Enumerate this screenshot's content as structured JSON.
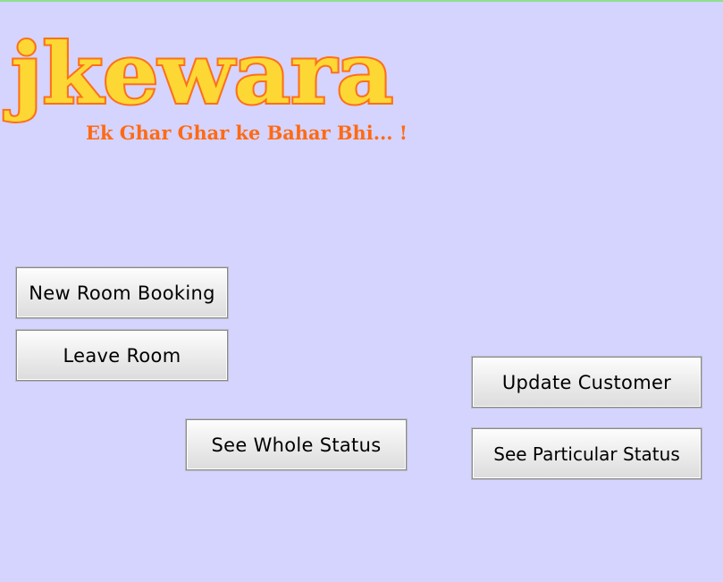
{
  "brand": {
    "name": "jkewara",
    "tagline": "Ek Ghar Ghar ke Bahar Bhi... !",
    "fill_color": "#fdd835",
    "outline_color": "#ff6f1a",
    "tagline_color": "#ff6a13"
  },
  "buttons": {
    "new_room_booking": "New Room Booking",
    "leave_room": "Leave Room",
    "see_whole_status": "See Whole Status",
    "update_customer": "Update Customer",
    "see_particular_status": "See Particular Status"
  },
  "colors": {
    "background": "#d4d4fe",
    "top_line": "#8fe08f"
  }
}
